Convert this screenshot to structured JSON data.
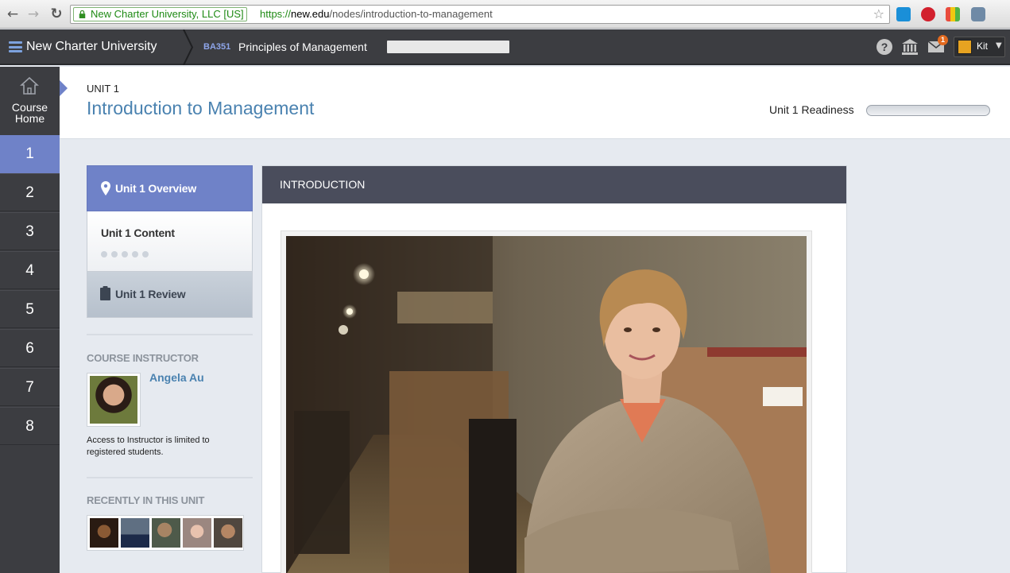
{
  "browser": {
    "ev_label": "New Charter University, LLC [US]",
    "url_scheme": "https://",
    "url_domain": "new.edu",
    "url_path": "/nodes/introduction-to-management"
  },
  "header": {
    "university": "New Charter University",
    "course_code": "BA351",
    "course_title": "Principles of Management",
    "mail_count": "1",
    "user_name": "Kit"
  },
  "rail": {
    "course_home": "Course Home",
    "units": [
      "1",
      "2",
      "3",
      "4",
      "5",
      "6",
      "7",
      "8"
    ],
    "active_unit": "1"
  },
  "unit": {
    "label": "UNIT 1",
    "title": "Introduction to Management",
    "readiness_label": "Unit 1 Readiness",
    "readiness_progress": 0
  },
  "sections": {
    "overview": "Unit 1 Overview",
    "content": "Unit 1 Content",
    "review": "Unit 1 Review"
  },
  "instructor": {
    "heading": "COURSE INSTRUCTOR",
    "name": "Angela Au",
    "note": "Access to Instructor is limited to registered students."
  },
  "recent": {
    "heading": "RECENTLY IN THIS UNIT"
  },
  "main": {
    "card_title": "INTRODUCTION"
  }
}
